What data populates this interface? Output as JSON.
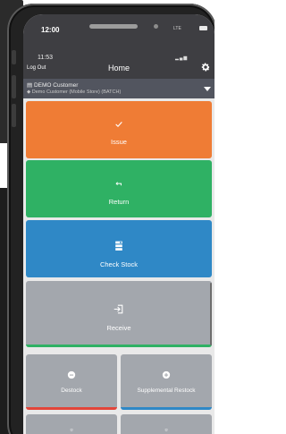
{
  "status_bar": {
    "time": "12:00",
    "carrier": "LTE"
  },
  "app_bar": {
    "inner_time": "11:53",
    "left_action": "Log Out",
    "title": "Home"
  },
  "customer": {
    "name": "DEMO Customer",
    "detail": "Demo Customer (Mobile Store) (BATCH)"
  },
  "tiles": {
    "issue": {
      "label": "Issue",
      "icon": "check-icon",
      "color": "#ef7c35"
    },
    "return": {
      "label": "Return",
      "icon": "return-arrow-icon",
      "color": "#2fb164"
    },
    "check_stock": {
      "label": "Check Stock",
      "icon": "stock-list-icon",
      "color": "#2f88c6"
    },
    "receive": {
      "label": "Receive",
      "icon": "receive-icon",
      "color": "#a3a7ad",
      "accent": "#2fb164"
    },
    "destock": {
      "label": "Destock",
      "icon": "minus-circle-icon",
      "accent": "#e2453a"
    },
    "supplemental_restock": {
      "label": "Supplemental Restock",
      "icon": "plus-circle-icon",
      "accent": "#2f88c6"
    }
  }
}
